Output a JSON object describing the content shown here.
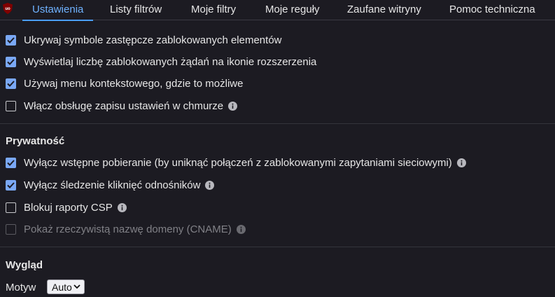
{
  "tabs": [
    {
      "label": "Ustawienia",
      "active": true
    },
    {
      "label": "Listy filtrów",
      "active": false
    },
    {
      "label": "Moje filtry",
      "active": false
    },
    {
      "label": "Moje reguły",
      "active": false
    },
    {
      "label": "Zaufane witryny",
      "active": false
    },
    {
      "label": "Pomoc techniczna",
      "active": false
    }
  ],
  "general": {
    "options": [
      {
        "label": "Ukrywaj symbole zastępcze zablokowanych elementów",
        "checked": true,
        "info": false
      },
      {
        "label": "Wyświetlaj liczbę zablokowanych żądań na ikonie rozszerzenia",
        "checked": true,
        "info": false
      },
      {
        "label": "Używaj menu kontekstowego, gdzie to możliwe",
        "checked": true,
        "info": false
      },
      {
        "label": "Włącz obsługę zapisu ustawień w chmurze",
        "checked": false,
        "info": true
      }
    ]
  },
  "privacy": {
    "title": "Prywatność",
    "options": [
      {
        "label": "Wyłącz wstępne pobieranie (by uniknąć połączeń z zablokowanymi zapytaniami sieciowymi)",
        "checked": true,
        "info": true
      },
      {
        "label": "Wyłącz śledzenie kliknięć odnośników",
        "checked": true,
        "info": true
      },
      {
        "label": "Blokuj raporty CSP",
        "checked": false,
        "info": true
      },
      {
        "label": "Pokaż rzeczywistą nazwę domeny (CNAME)",
        "checked": false,
        "disabled": true,
        "info": true
      }
    ]
  },
  "appearance": {
    "title": "Wygląd",
    "theme_label": "Motyw",
    "theme_value": "Auto"
  },
  "colors": {
    "accent": "#4a9eff",
    "checkbox": "#7aa8f5",
    "background": "#1c1b22",
    "logo": "#800000"
  },
  "icons": {
    "logo": "ublock-shield-icon",
    "info": "info-circle-icon",
    "dropdown": "chevron-down-icon"
  }
}
